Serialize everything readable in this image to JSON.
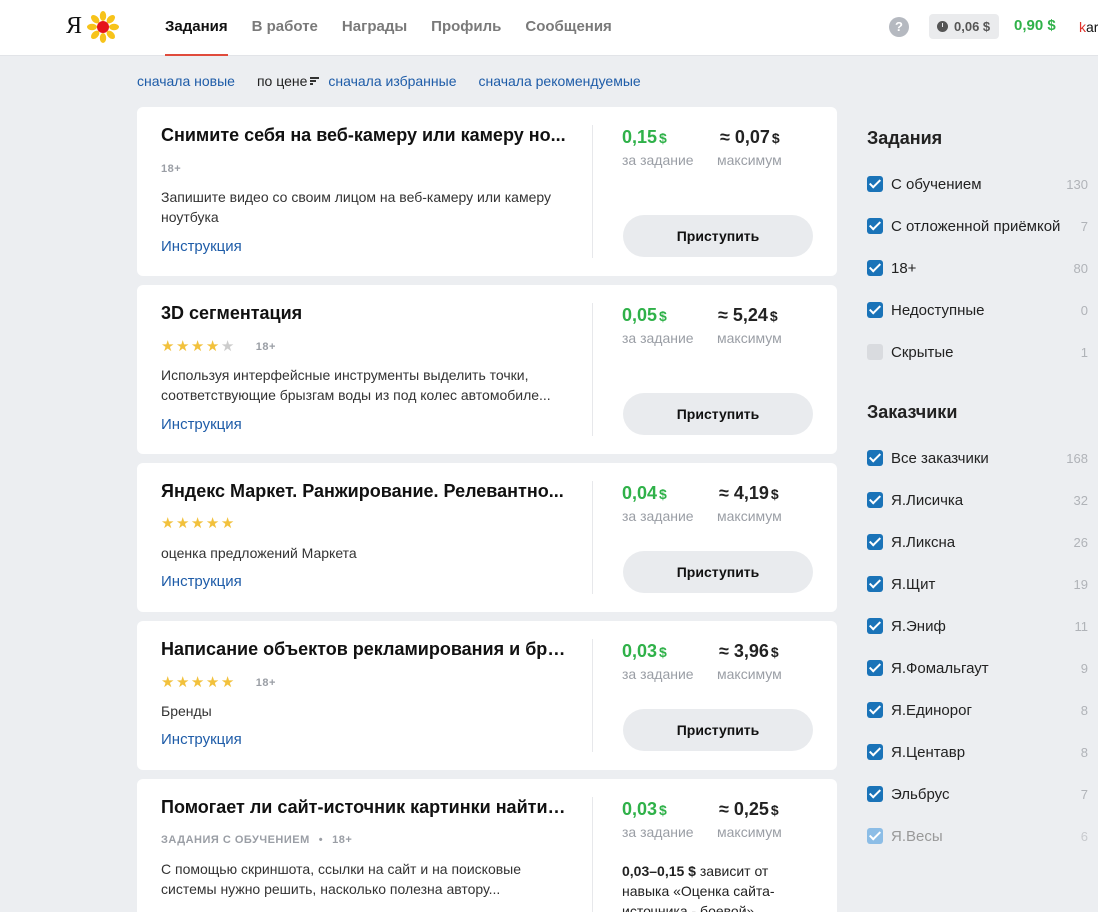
{
  "header": {
    "logo_text": "Я",
    "nav": [
      "Задания",
      "В работе",
      "Награды",
      "Профиль",
      "Сообщения"
    ],
    "active_nav": 0,
    "help_icon": "?",
    "pending_amount": "0,06 $",
    "balance": "0,90 $",
    "username_first": "k",
    "username_rest": "ar"
  },
  "sort": {
    "newest": "сначала новые",
    "by_price": "по цене",
    "favorites": "сначала избранные",
    "recommended": "сначала рекомендуемые"
  },
  "tasks": [
    {
      "title": "Снимите себя на веб-камеру или камеру но...",
      "badge": "18+",
      "description": "Запишите видео со своим лицом на веб-камеру или камеру ноутбука",
      "instruction": "Инструкция",
      "price": "0,15",
      "price_currency": "$",
      "price_label": "за задание",
      "max": "≈ 0,07",
      "max_currency": "$",
      "max_label": "максимум",
      "button": "Приступить"
    },
    {
      "title": "3D сегментация",
      "rating_stars": 4.5,
      "badge": "18+",
      "description": "Используя интерфейсные инструменты выделить точки, соответствующие брызгам воды из под колес автомобиле...",
      "instruction": "Инструкция",
      "price": "0,05",
      "price_currency": "$",
      "price_label": "за задание",
      "max": "≈ 5,24",
      "max_currency": "$",
      "max_label": "максимум",
      "button": "Приступить"
    },
    {
      "title": "Яндекс Маркет. Ранжирование. Релевантно...",
      "rating_stars": 5,
      "description": "оценка предложений Маркета",
      "instruction": "Инструкция",
      "price": "0,04",
      "price_currency": "$",
      "price_label": "за задание",
      "max": "≈ 4,19",
      "max_currency": "$",
      "max_label": "максимум",
      "button": "Приступить"
    },
    {
      "title": "Написание объектов рекламирования и бре...",
      "rating_stars": 5,
      "badge": "18+",
      "description": "Бренды",
      "instruction": "Инструкция",
      "price": "0,03",
      "price_currency": "$",
      "price_label": "за задание",
      "max": "≈ 3,96",
      "max_currency": "$",
      "max_label": "максимум",
      "button": "Приступить"
    },
    {
      "title": "Помогает ли сайт-источник картинки найти ...",
      "training_badge": "ЗАДАНИЯ С ОБУЧЕНИЕМ",
      "separator": "•",
      "badge": "18+",
      "description": "С помощью скриншота, ссылки на сайт и на поисковые системы нужно решить, насколько полезна автору...",
      "price": "0,03",
      "price_currency": "$",
      "price_label": "за задание",
      "max": "≈ 0,25",
      "max_currency": "$",
      "max_label": "максимум",
      "depends_amount": "0,03–0,15 $",
      "depends_text": "зависит от навыка «Оценка сайта-источника - боевой»"
    }
  ],
  "sidebar": {
    "tasks_heading": "Задания",
    "task_filters": [
      {
        "label": "С обучением",
        "count": "130",
        "checked": true
      },
      {
        "label": "С отложенной приёмкой",
        "count": "7",
        "checked": true
      },
      {
        "label": "18+",
        "count": "80",
        "checked": true
      },
      {
        "label": "Недоступные",
        "count": "0",
        "checked": true
      },
      {
        "label": "Скрытые",
        "count": "1",
        "checked": false
      }
    ],
    "customers_heading": "Заказчики",
    "customer_filters": [
      {
        "label": "Все заказчики",
        "count": "168",
        "checked": true
      },
      {
        "label": "Я.Лисичка",
        "count": "32",
        "checked": true
      },
      {
        "label": "Я.Ликсна",
        "count": "26",
        "checked": true
      },
      {
        "label": "Я.Щит",
        "count": "19",
        "checked": true
      },
      {
        "label": "Я.Эниф",
        "count": "11",
        "checked": true
      },
      {
        "label": "Я.Фомальгаут",
        "count": "9",
        "checked": true
      },
      {
        "label": "Я.Единорог",
        "count": "8",
        "checked": true
      },
      {
        "label": "Я.Центавр",
        "count": "8",
        "checked": true
      },
      {
        "label": "Эльбрус",
        "count": "7",
        "checked": true
      },
      {
        "label": "Я.Весы",
        "count": "6",
        "checked": true
      }
    ]
  },
  "colors": {
    "accent_green": "#2fb149",
    "link_blue": "#1e5ca8",
    "checkbox_blue": "#1a73b8",
    "active_underline": "#e04b3c"
  }
}
